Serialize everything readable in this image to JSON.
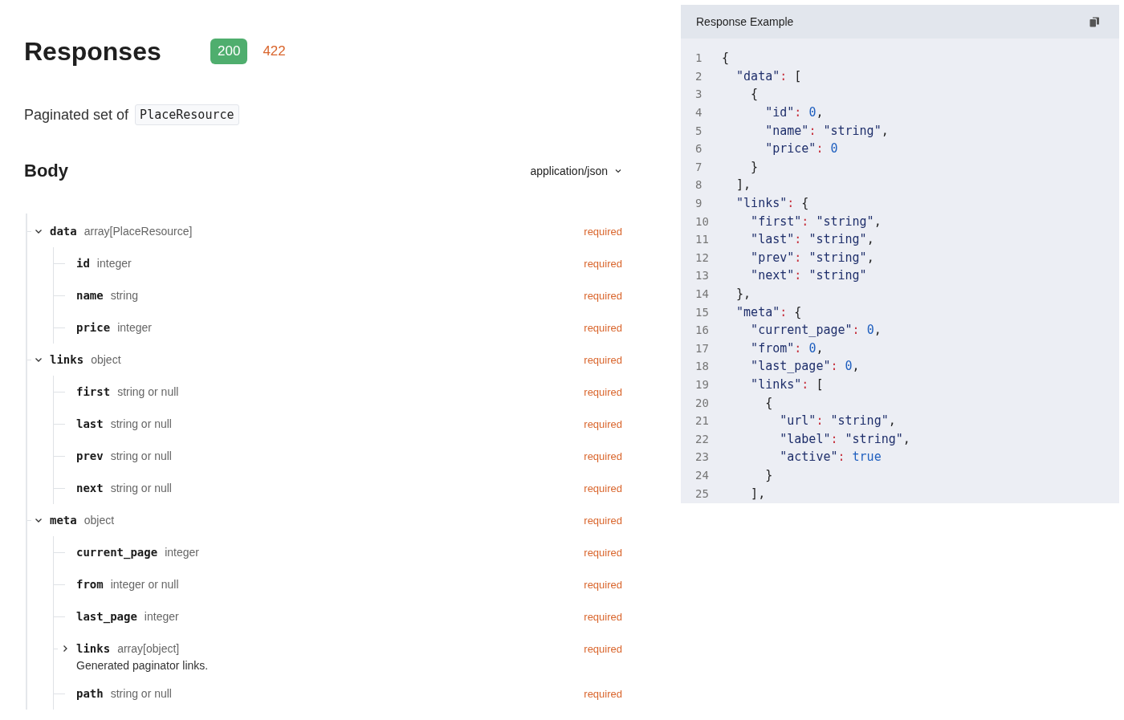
{
  "title": "Responses",
  "status_tabs": [
    {
      "label": "200",
      "selected": true
    },
    {
      "label": "422",
      "selected": false
    }
  ],
  "summary": {
    "text": "Paginated set of",
    "code": "PlaceResource"
  },
  "body": {
    "title": "Body",
    "content_type": "application/json"
  },
  "fields": [
    {
      "name": "data",
      "type": "array[PlaceResource]",
      "required": "required",
      "expanded": true,
      "children": [
        {
          "name": "id",
          "type": "integer",
          "required": "required"
        },
        {
          "name": "name",
          "type": "string",
          "required": "required"
        },
        {
          "name": "price",
          "type": "integer",
          "required": "required"
        }
      ]
    },
    {
      "name": "links",
      "type": "object",
      "required": "required",
      "expanded": true,
      "children": [
        {
          "name": "first",
          "type": "string or null",
          "required": "required"
        },
        {
          "name": "last",
          "type": "string or null",
          "required": "required"
        },
        {
          "name": "prev",
          "type": "string or null",
          "required": "required"
        },
        {
          "name": "next",
          "type": "string or null",
          "required": "required"
        }
      ]
    },
    {
      "name": "meta",
      "type": "object",
      "required": "required",
      "expanded": true,
      "children": [
        {
          "name": "current_page",
          "type": "integer",
          "required": "required"
        },
        {
          "name": "from",
          "type": "integer or null",
          "required": "required"
        },
        {
          "name": "last_page",
          "type": "integer",
          "required": "required"
        },
        {
          "name": "links",
          "type": "array[object]",
          "required": "required",
          "expanded": false,
          "description": "Generated paginator links."
        },
        {
          "name": "path",
          "type": "string or null",
          "required": "required"
        }
      ]
    }
  ],
  "example": {
    "title": "Response Example",
    "lines": [
      {
        "n": "1",
        "tokens": [
          {
            "kind": "punct",
            "t": "{"
          }
        ]
      },
      {
        "n": "2",
        "tokens": [
          {
            "kind": "key",
            "t": "  \"data\""
          },
          {
            "kind": "colon",
            "t": ": "
          },
          {
            "kind": "punct",
            "t": "["
          }
        ]
      },
      {
        "n": "3",
        "tokens": [
          {
            "kind": "punct",
            "t": "    {"
          }
        ]
      },
      {
        "n": "4",
        "tokens": [
          {
            "kind": "key",
            "t": "      \"id\""
          },
          {
            "kind": "colon",
            "t": ": "
          },
          {
            "kind": "number",
            "t": "0"
          },
          {
            "kind": "punct",
            "t": ","
          }
        ]
      },
      {
        "n": "5",
        "tokens": [
          {
            "kind": "key",
            "t": "      \"name\""
          },
          {
            "kind": "colon",
            "t": ": "
          },
          {
            "kind": "string",
            "t": "\"string\""
          },
          {
            "kind": "punct",
            "t": ","
          }
        ]
      },
      {
        "n": "6",
        "tokens": [
          {
            "kind": "key",
            "t": "      \"price\""
          },
          {
            "kind": "colon",
            "t": ": "
          },
          {
            "kind": "number",
            "t": "0"
          }
        ]
      },
      {
        "n": "7",
        "tokens": [
          {
            "kind": "punct",
            "t": "    }"
          }
        ]
      },
      {
        "n": "8",
        "tokens": [
          {
            "kind": "punct",
            "t": "  ],"
          }
        ]
      },
      {
        "n": "9",
        "tokens": [
          {
            "kind": "key",
            "t": "  \"links\""
          },
          {
            "kind": "colon",
            "t": ": "
          },
          {
            "kind": "punct",
            "t": "{"
          }
        ]
      },
      {
        "n": "10",
        "tokens": [
          {
            "kind": "key",
            "t": "    \"first\""
          },
          {
            "kind": "colon",
            "t": ": "
          },
          {
            "kind": "string",
            "t": "\"string\""
          },
          {
            "kind": "punct",
            "t": ","
          }
        ]
      },
      {
        "n": "11",
        "tokens": [
          {
            "kind": "key",
            "t": "    \"last\""
          },
          {
            "kind": "colon",
            "t": ": "
          },
          {
            "kind": "string",
            "t": "\"string\""
          },
          {
            "kind": "punct",
            "t": ","
          }
        ]
      },
      {
        "n": "12",
        "tokens": [
          {
            "kind": "key",
            "t": "    \"prev\""
          },
          {
            "kind": "colon",
            "t": ": "
          },
          {
            "kind": "string",
            "t": "\"string\""
          },
          {
            "kind": "punct",
            "t": ","
          }
        ]
      },
      {
        "n": "13",
        "tokens": [
          {
            "kind": "key",
            "t": "    \"next\""
          },
          {
            "kind": "colon",
            "t": ": "
          },
          {
            "kind": "string",
            "t": "\"string\""
          }
        ]
      },
      {
        "n": "14",
        "tokens": [
          {
            "kind": "punct",
            "t": "  },"
          }
        ]
      },
      {
        "n": "15",
        "tokens": [
          {
            "kind": "key",
            "t": "  \"meta\""
          },
          {
            "kind": "colon",
            "t": ": "
          },
          {
            "kind": "punct",
            "t": "{"
          }
        ]
      },
      {
        "n": "16",
        "tokens": [
          {
            "kind": "key",
            "t": "    \"current_page\""
          },
          {
            "kind": "colon",
            "t": ": "
          },
          {
            "kind": "number",
            "t": "0"
          },
          {
            "kind": "punct",
            "t": ","
          }
        ]
      },
      {
        "n": "17",
        "tokens": [
          {
            "kind": "key",
            "t": "    \"from\""
          },
          {
            "kind": "colon",
            "t": ": "
          },
          {
            "kind": "number",
            "t": "0"
          },
          {
            "kind": "punct",
            "t": ","
          }
        ]
      },
      {
        "n": "18",
        "tokens": [
          {
            "kind": "key",
            "t": "    \"last_page\""
          },
          {
            "kind": "colon",
            "t": ": "
          },
          {
            "kind": "number",
            "t": "0"
          },
          {
            "kind": "punct",
            "t": ","
          }
        ]
      },
      {
        "n": "19",
        "tokens": [
          {
            "kind": "key",
            "t": "    \"links\""
          },
          {
            "kind": "colon",
            "t": ": "
          },
          {
            "kind": "punct",
            "t": "["
          }
        ]
      },
      {
        "n": "20",
        "tokens": [
          {
            "kind": "punct",
            "t": "      {"
          }
        ]
      },
      {
        "n": "21",
        "tokens": [
          {
            "kind": "key",
            "t": "        \"url\""
          },
          {
            "kind": "colon",
            "t": ": "
          },
          {
            "kind": "string",
            "t": "\"string\""
          },
          {
            "kind": "punct",
            "t": ","
          }
        ]
      },
      {
        "n": "22",
        "tokens": [
          {
            "kind": "key",
            "t": "        \"label\""
          },
          {
            "kind": "colon",
            "t": ": "
          },
          {
            "kind": "string",
            "t": "\"string\""
          },
          {
            "kind": "punct",
            "t": ","
          }
        ]
      },
      {
        "n": "23",
        "tokens": [
          {
            "kind": "key",
            "t": "        \"active\""
          },
          {
            "kind": "colon",
            "t": ": "
          },
          {
            "kind": "number",
            "t": "true"
          }
        ]
      },
      {
        "n": "24",
        "tokens": [
          {
            "kind": "punct",
            "t": "      }"
          }
        ]
      },
      {
        "n": "25",
        "tokens": [
          {
            "kind": "punct",
            "t": "    ],"
          }
        ]
      }
    ]
  }
}
